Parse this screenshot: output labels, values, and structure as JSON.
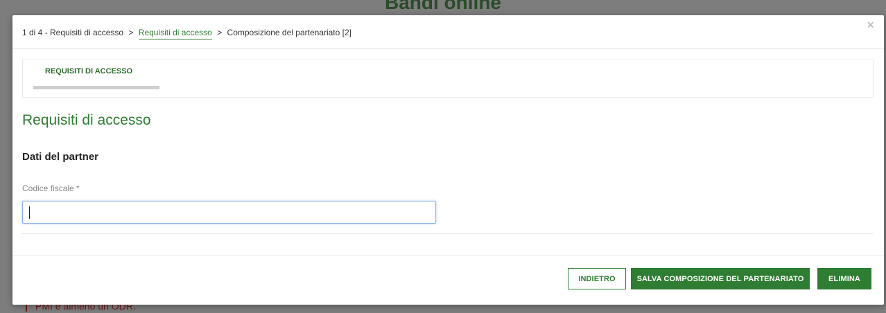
{
  "background": {
    "title": "Bandi online",
    "footer_text": "PMI e almeno un ODR."
  },
  "modal": {
    "breadcrumb": [
      {
        "label": "1 di 4 - Requisiti di accesso",
        "link": false
      },
      {
        "label": ">",
        "link": false
      },
      {
        "label": "Requisiti di accesso",
        "link": true
      },
      {
        "label": ">",
        "link": false
      },
      {
        "label": "Composizione del partenariato [2]",
        "link": false
      }
    ],
    "close_icon": "×",
    "step": {
      "label": "REQUISITI DI ACCESSO"
    },
    "section_title": "Requisiti di accesso",
    "subsection_title": "Dati del partner",
    "field": {
      "label": "Codice fiscale *",
      "value": "",
      "placeholder": ""
    },
    "buttons": {
      "back": "INDIETRO",
      "save": "SALVA COMPOSIZIONE DEL PARTENARIATO",
      "delete": "ELIMINA"
    }
  },
  "colors": {
    "accent": "#2e7d32",
    "overlay": "#7d7d7d"
  }
}
